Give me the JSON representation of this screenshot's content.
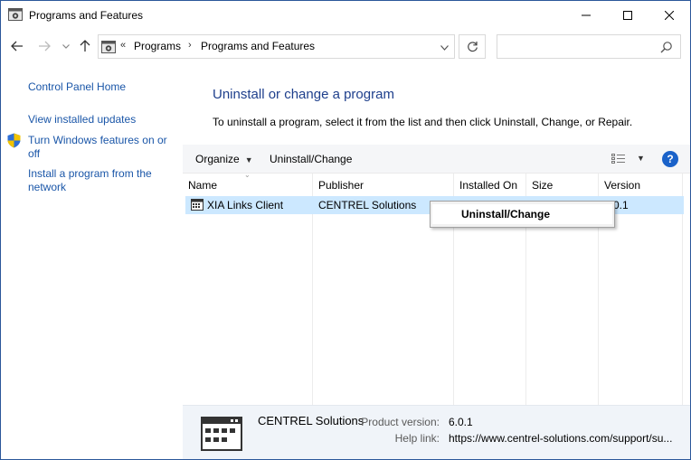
{
  "window": {
    "title": "Programs and Features"
  },
  "address": {
    "overflow": "«",
    "crumbs": [
      "Programs",
      "Programs and Features"
    ],
    "search_placeholder": ""
  },
  "left": {
    "home": "Control Panel Home",
    "updates": "View installed updates",
    "features_line1": "Turn Windows features on or",
    "features_line2": "off",
    "install_line1": "Install a program from the",
    "install_line2": "network"
  },
  "main": {
    "heading": "Uninstall or change a program",
    "instructions": "To uninstall a program, select it from the list and then click Uninstall, Change, or Repair."
  },
  "toolbar": {
    "organize": "Organize",
    "uninstall_change": "Uninstall/Change"
  },
  "list": {
    "columns": [
      "Name",
      "Publisher",
      "Installed On",
      "Size",
      "Version"
    ],
    "rows": [
      {
        "name": "XIA Links Client",
        "publisher": "CENTREL Solutions",
        "installed_on": "",
        "size": "",
        "version": "6.0.1"
      }
    ]
  },
  "context_menu": {
    "items": [
      "Uninstall/Change"
    ]
  },
  "details": {
    "publisher": "CENTREL Solutions",
    "product_version_label": "Product version:",
    "product_version": "6.0.1",
    "help_link_label": "Help link:",
    "help_link": "https://www.centrel-solutions.com/support/su..."
  },
  "colors": {
    "link": "#1a56a8",
    "heading": "#1e3f8c",
    "selection": "#cce8ff",
    "help": "#1a62c9"
  }
}
